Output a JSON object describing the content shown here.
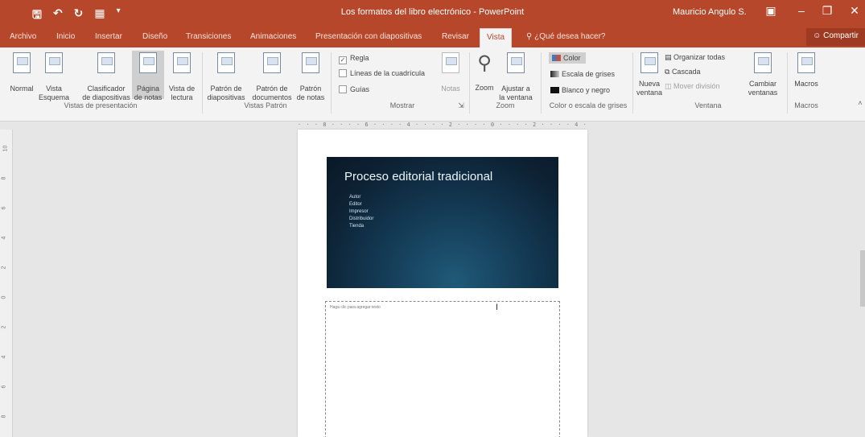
{
  "app": {
    "window_title": "Los formatos del libro electrónico - PowerPoint",
    "user": "Mauricio Angulo S."
  },
  "colors": {
    "accent": "#b7472a",
    "ribbon": "#f3f3f3",
    "workspace": "#e6e6e6"
  },
  "tabs": [
    {
      "label": "Archivo"
    },
    {
      "label": "Inicio"
    },
    {
      "label": "Insertar"
    },
    {
      "label": "Diseño"
    },
    {
      "label": "Transiciones"
    },
    {
      "label": "Animaciones"
    },
    {
      "label": "Presentación con diapositivas"
    },
    {
      "label": "Revisar"
    },
    {
      "label": "Vista",
      "active": true
    },
    {
      "label": "¿Qué desea hacer?"
    }
  ],
  "share_label": "Compartir",
  "ribbon": {
    "presentation_views": {
      "group": "Vistas de presentación",
      "normal": "Normal",
      "outline_l1": "Vista",
      "outline_l2": "Esquema",
      "sorter_l1": "Clasificador",
      "sorter_l2": "de diapositivas",
      "notes_l1": "Página",
      "notes_l2": "de notas",
      "reading_l1": "Vista de",
      "reading_l2": "lectura"
    },
    "master_views": {
      "group": "Vistas Patrón",
      "slide_master_l1": "Patrón de",
      "slide_master_l2": "diapositivas",
      "handout_master_l1": "Patrón de",
      "handout_master_l2": "documentos",
      "notes_master_l1": "Patrón",
      "notes_master_l2": "de notas"
    },
    "show": {
      "group": "Mostrar",
      "ruler": "Regla",
      "gridlines": "Líneas de la cuadrícula",
      "guides": "Guías",
      "notes": "Notas"
    },
    "zoom": {
      "group": "Zoom",
      "zoom": "Zoom",
      "fit_l1": "Ajustar a",
      "fit_l2": "la ventana"
    },
    "color": {
      "group": "Color o escala de grises",
      "color": "Color",
      "grayscale": "Escala de grises",
      "bw": "Blanco y negro"
    },
    "window": {
      "group": "Ventana",
      "new_l1": "Nueva",
      "new_l2": "ventana",
      "arrange_all": "Organizar todas",
      "cascade": "Cascada",
      "move_split": "Mover división"
    },
    "switch_windows": {
      "l1": "Cambiar",
      "l2": "ventanas"
    },
    "macros": {
      "group": "Macros",
      "macros": "Macros"
    }
  },
  "ruler_text": "· · · 8 · · · · 6 · · · · 4 · · · · 2 · · · · 0 · · · · 2 · · · · 4 · · · · 6 · · · · 8 · · ·",
  "vruler_marks": [
    "10",
    "8",
    "6",
    "4",
    "2",
    "0",
    "2",
    "4",
    "6",
    "8"
  ],
  "slide": {
    "title": "Proceso editorial tradicional",
    "bullets": [
      "Autor",
      "Editor",
      "Impresor",
      "Distribuidor",
      "Tienda"
    ]
  },
  "notes_placeholder": "Haga clic para agregar texto"
}
